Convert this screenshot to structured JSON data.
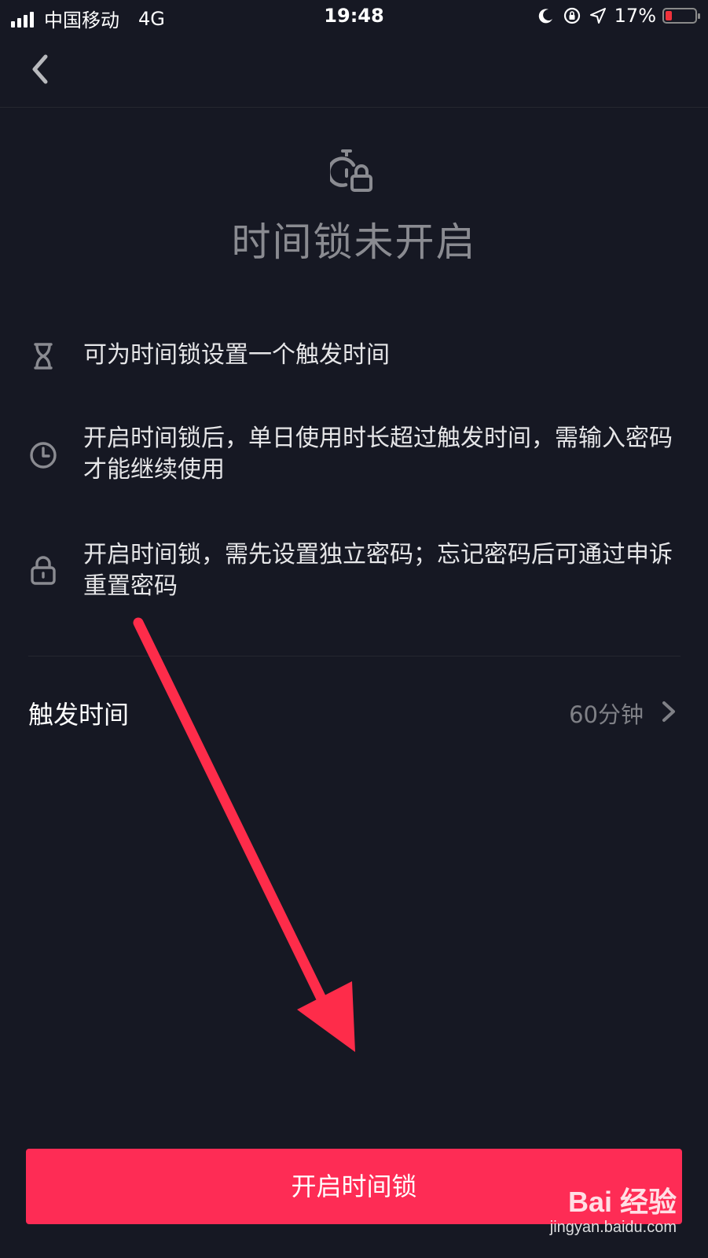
{
  "status_bar": {
    "carrier": "中国移动",
    "network": "4G",
    "time": "19:48",
    "battery_percent": "17%"
  },
  "hero": {
    "title": "时间锁未开启",
    "icon": "stopwatch-lock-icon"
  },
  "info_items": [
    {
      "icon": "hourglass-icon",
      "text": "可为时间锁设置一个触发时间"
    },
    {
      "icon": "clock-icon",
      "text": "开启时间锁后，单日使用时长超过触发时间，需输入密码才能继续使用"
    },
    {
      "icon": "lock-icon",
      "text": "开启时间锁，需先设置独立密码；忘记密码后可通过申诉重置密码"
    }
  ],
  "trigger": {
    "label": "触发时间",
    "value": "60分钟"
  },
  "primary_button": {
    "label": "开启时间锁"
  },
  "watermark": {
    "logo": "Bai 经验",
    "url": "jingyan.baidu.com"
  },
  "colors": {
    "background": "#161823",
    "accent": "#fe2c55",
    "annotation_arrow": "#fe2c4a",
    "muted_text": "#7f8086"
  }
}
